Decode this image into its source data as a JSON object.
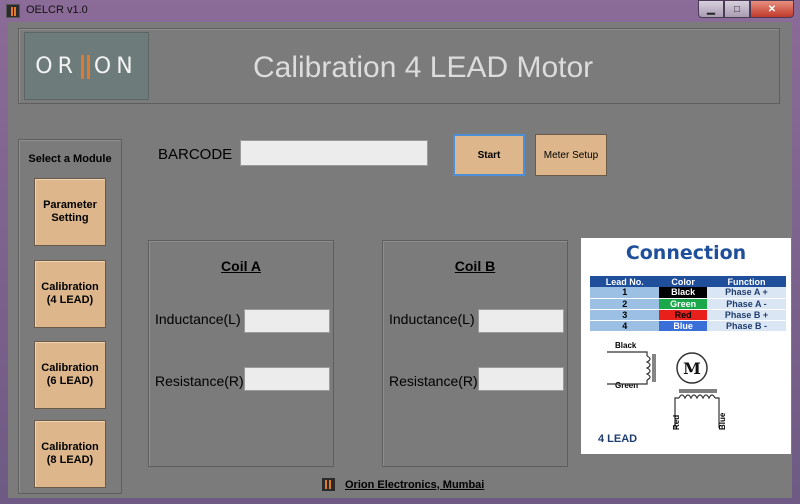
{
  "window": {
    "title": "OELCR v1.0",
    "min_symbol": "▁",
    "max_symbol": "□",
    "close_symbol": "✕"
  },
  "header": {
    "logo_left": "OR",
    "logo_right": "ON",
    "title": "Calibration 4 LEAD Motor"
  },
  "modules": {
    "heading": "Select a Module",
    "items": [
      {
        "line1": "Parameter",
        "line2": "Setting"
      },
      {
        "line1": "Calibration",
        "line2": "(4 LEAD)"
      },
      {
        "line1": "Calibration",
        "line2": "(6 LEAD)"
      },
      {
        "line1": "Calibration",
        "line2": "(8 LEAD)"
      }
    ]
  },
  "barcode": {
    "label": "BARCODE",
    "value": ""
  },
  "buttons": {
    "start": "Start",
    "meter_setup": "Meter Setup"
  },
  "coil_a": {
    "title": "Coil A",
    "inductance_label": "Inductance(L)",
    "resistance_label": "Resistance(R)"
  },
  "coil_b": {
    "title": "Coil B",
    "inductance_label": "Inductance(L)",
    "resistance_label": "Resistance(R)"
  },
  "connection": {
    "title": "Connection",
    "headers": [
      "Lead No.",
      "Color",
      "Function"
    ],
    "rows": [
      {
        "no": "1",
        "color": "Black",
        "function": "Phase A +",
        "swatch": "#000000",
        "text_color": "#ffffff"
      },
      {
        "no": "2",
        "color": "Green",
        "function": "Phase A -",
        "swatch": "#1aa84a",
        "text_color": "#ffffff"
      },
      {
        "no": "3",
        "color": "Red",
        "function": "Phase B +",
        "swatch": "#e8201c",
        "text_color": "#000000"
      },
      {
        "no": "4",
        "color": "Blue",
        "function": "Phase B -",
        "swatch": "#3a6fd8",
        "text_color": "#ffffff"
      }
    ],
    "diagram": {
      "black": "Black",
      "green": "Green",
      "motor": "M",
      "red": "Red",
      "blue": "Blue"
    },
    "lead_tag": "4 LEAD"
  },
  "footer": {
    "text": "Orion Electronics, Mumbai"
  },
  "colors": {
    "accent": "#e07a2e",
    "button": "#ddb68b",
    "panel": "#7b7b7b",
    "diagram_title": "#1f4f9a"
  }
}
